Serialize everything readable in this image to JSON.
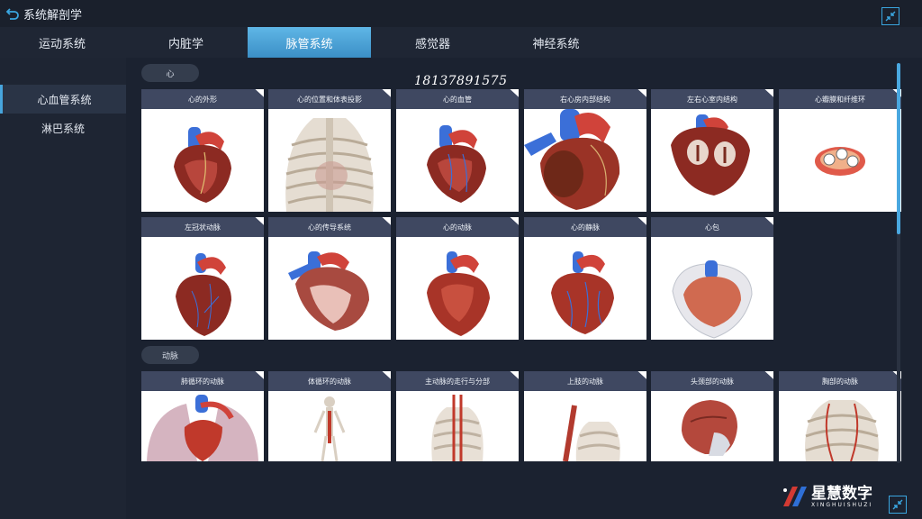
{
  "header": {
    "title": "系统解剖学"
  },
  "tabs": [
    {
      "label": "运动系统",
      "active": false
    },
    {
      "label": "内脏学",
      "active": false
    },
    {
      "label": "脉管系统",
      "active": true
    },
    {
      "label": "感觉器",
      "active": false
    },
    {
      "label": "神经系统",
      "active": false
    }
  ],
  "sidebar": {
    "items": [
      {
        "label": "心血管系统",
        "active": true
      },
      {
        "label": "淋巴系统",
        "active": false
      }
    ]
  },
  "sections": [
    {
      "label": "心",
      "cards": [
        {
          "title": "心的外形",
          "icon": "heart-exterior"
        },
        {
          "title": "心的位置和体表投影",
          "icon": "ribcage"
        },
        {
          "title": "心的血管",
          "icon": "heart-vessels"
        },
        {
          "title": "右心房内部结构",
          "icon": "right-atrium"
        },
        {
          "title": "左右心室内结构",
          "icon": "ventricles"
        },
        {
          "title": "心瓣膜和纤维环",
          "icon": "heart-valves"
        },
        {
          "title": "左冠状动脉",
          "icon": "left-coronary"
        },
        {
          "title": "心的传导系统",
          "icon": "conduction-system"
        },
        {
          "title": "心的动脉",
          "icon": "heart-arteries"
        },
        {
          "title": "心的静脉",
          "icon": "heart-veins"
        },
        {
          "title": "心包",
          "icon": "pericardium"
        }
      ]
    },
    {
      "label": "动脉",
      "cards": [
        {
          "title": "肺循环的动脉",
          "icon": "lungs"
        },
        {
          "title": "体循环的动脉",
          "icon": "skeleton"
        },
        {
          "title": "主动脉的走行与分部",
          "icon": "aorta"
        },
        {
          "title": "上肢的动脉",
          "icon": "upper-limb"
        },
        {
          "title": "头颈部的动脉",
          "icon": "head-neck"
        },
        {
          "title": "胸部的动脉",
          "icon": "thorax"
        }
      ]
    }
  ],
  "overlay": {
    "phone": "18137891575"
  },
  "brand": {
    "name_cn": "星慧数字",
    "name_en": "XINGHUISHUZI"
  },
  "colors": {
    "accent": "#47a5dd",
    "card_header": "#3f4861",
    "background": "#1b2230"
  }
}
